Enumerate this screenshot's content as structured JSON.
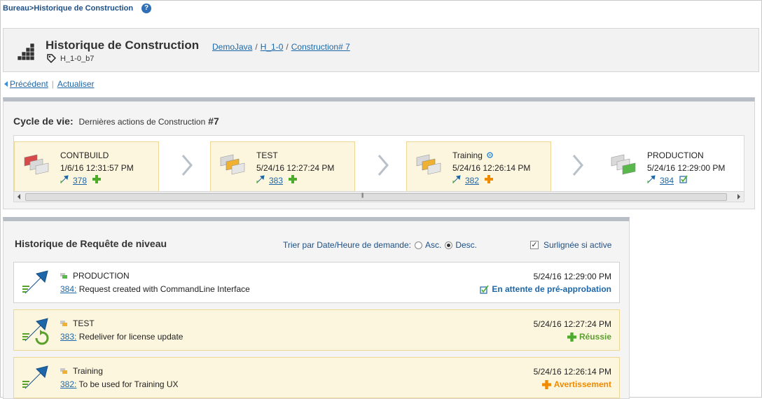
{
  "breadcrumb": {
    "text": "Bureau>Historique de Construction",
    "help_icon": "help-icon"
  },
  "header": {
    "title": "Historique de Construction",
    "crumbs": [
      "DemoJava",
      "H_1-0",
      "Construction# 7"
    ],
    "separator": "/",
    "tag": "H_1-0_b7"
  },
  "actions": {
    "previous": " Précédent",
    "refresh": "Actualiser",
    "divider": "|"
  },
  "lifecycle": {
    "title": "Cycle de vie:",
    "subtitle": "Dernières actions de Construction",
    "build_number": "#7",
    "environments": [
      {
        "name": "CONTBUILD",
        "date": "1/6/16 12:31:57 PM",
        "request": "378",
        "status_icon": "plus-green-icon",
        "color": "#d64a4a",
        "highlighted": true
      },
      {
        "name": "TEST",
        "date": "5/24/16 12:27:24 PM",
        "request": "383",
        "status_icon": "plus-green-icon",
        "color": "#f0b030",
        "highlighted": true
      },
      {
        "name": "Training",
        "date": "5/24/16 12:26:14 PM",
        "request": "382",
        "status_icon": "plus-orange-icon",
        "color": "#f0b030",
        "highlighted": true
      },
      {
        "name": "PRODUCTION",
        "date": "5/24/16 12:29:00 PM",
        "request": "384",
        "status_icon": "approval-pending-icon",
        "color": "#58b84c",
        "highlighted": false
      }
    ]
  },
  "history": {
    "title": "Historique de Requête de niveau",
    "sort_label": "Trier par Date/Heure de demande:",
    "sort_asc": "Asc.",
    "sort_desc": "Desc.",
    "sort_selected": "Desc.",
    "highlight_label": "Surlignée si active",
    "highlight_checked": true,
    "requests": [
      {
        "env": "PRODUCTION",
        "id": "384:",
        "desc": "Request created with CommandLine Interface",
        "date": "5/24/16 12:29:00 PM",
        "status": "En attente de pré-approbation",
        "status_color": "#1d67a8",
        "highlighted": false
      },
      {
        "env": "TEST",
        "id": "383:",
        "desc": "Redeliver for license update",
        "date": "5/24/16 12:27:24 PM",
        "status": "Réussie",
        "status_color": "#5aa02c",
        "highlighted": true
      },
      {
        "env": "Training",
        "id": "382:",
        "desc": "To be used for Training UX",
        "date": "5/24/16 12:26:14 PM",
        "status": "Avertissement",
        "status_color": "#f08a00",
        "highlighted": true
      }
    ]
  },
  "colors": {
    "link": "#1d67a8",
    "highlight_bg": "#fdf6df",
    "highlight_border": "#ecd795"
  }
}
